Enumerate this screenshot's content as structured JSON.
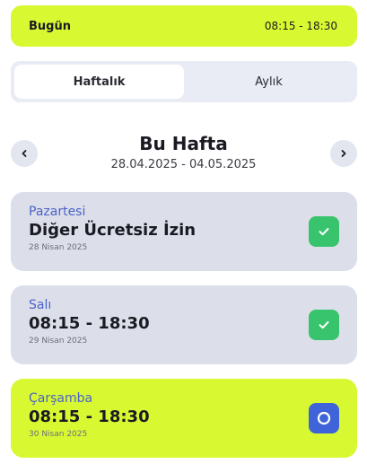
{
  "today": {
    "label": "Bugün",
    "time": "08:15 - 18:30"
  },
  "tabs": [
    {
      "label": "Haftalık",
      "active": true
    },
    {
      "label": "Aylık",
      "active": false
    }
  ],
  "week": {
    "title": "Bu Hafta",
    "range": "28.04.2025 - 04.05.2025"
  },
  "days": [
    {
      "name": "Pazartesi",
      "value": "Diğer Ücretsiz İzin",
      "date": "28 Nisan 2025",
      "status": "done",
      "status_icon": "check-icon"
    },
    {
      "name": "Salı",
      "value": "08:15 - 18:30",
      "date": "29 Nisan 2025",
      "status": "done",
      "status_icon": "check-icon"
    },
    {
      "name": "Çarşamba",
      "value": "08:15 - 18:30",
      "date": "30 Nisan 2025",
      "status": "pending",
      "status_icon": "circle-icon"
    }
  ],
  "colors": {
    "accent": "#d8f932",
    "card_grey": "#dcdfe9",
    "day_name": "#4a62c9",
    "done": "#38c46c",
    "pending": "#3f63d9"
  }
}
